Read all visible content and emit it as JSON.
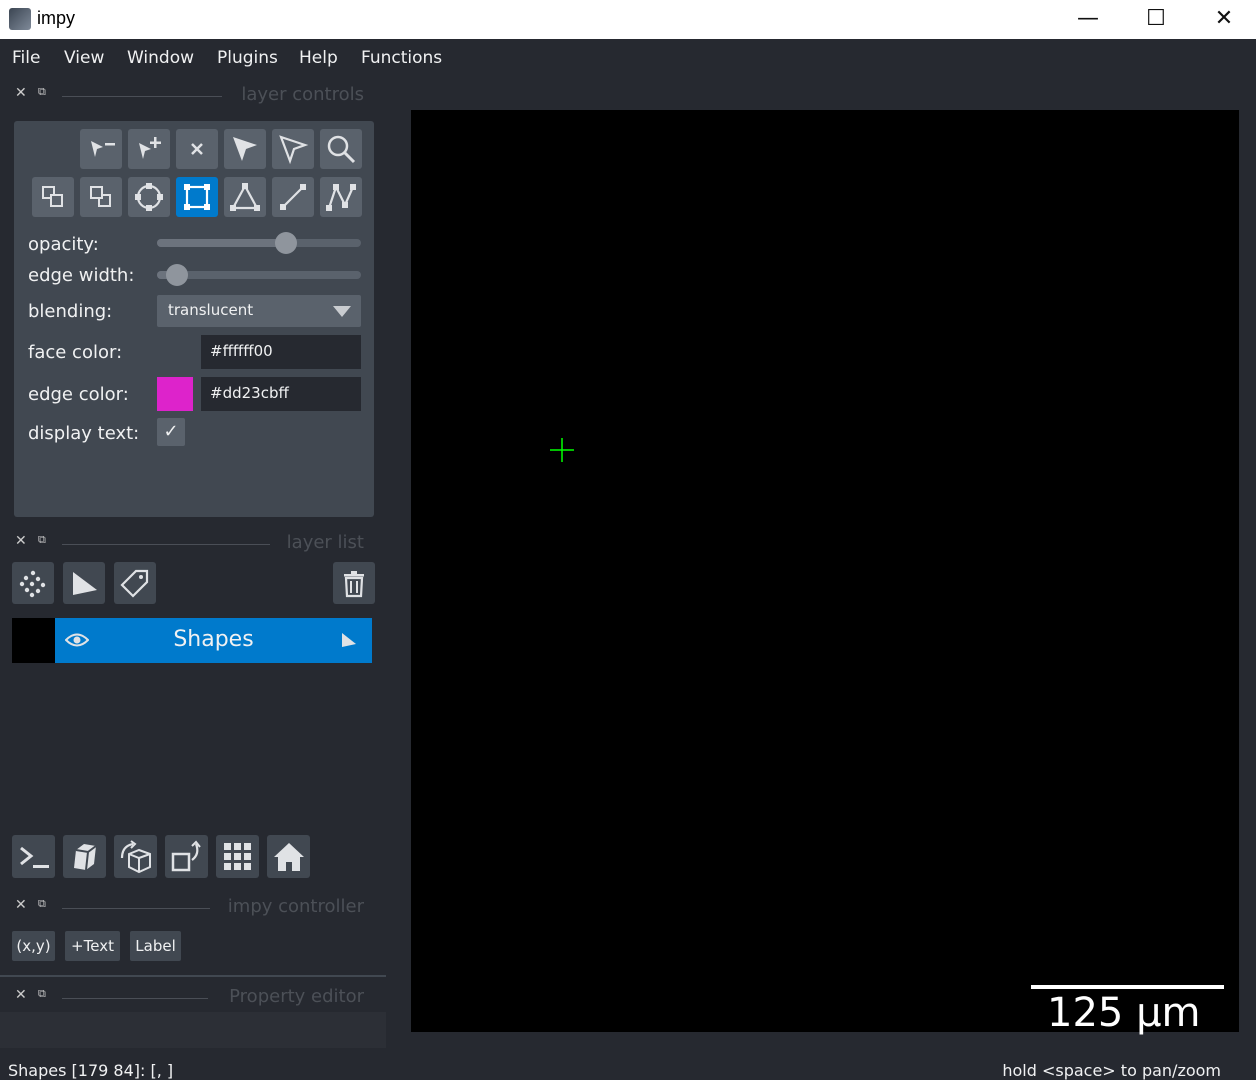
{
  "window": {
    "title": "impy",
    "minimize": "—",
    "maximize": "☐",
    "close": "✕"
  },
  "menu": [
    "File",
    "View",
    "Window",
    "Plugins",
    "Help",
    "Functions"
  ],
  "docks": {
    "layer_controls": "layer controls",
    "layer_list": "layer list",
    "impy_controller": "impy controller",
    "property_editor": "Property editor"
  },
  "layer_controls": {
    "opacity": {
      "label": "opacity:",
      "value": 0.65
    },
    "edge_width": {
      "label": "edge width:",
      "value": 0.05
    },
    "blending": {
      "label": "blending:",
      "value": "translucent"
    },
    "face_color": {
      "label": "face color:",
      "value": "#ffffff00"
    },
    "edge_color": {
      "label": "edge color:",
      "value": "#dd23cbff",
      "swatch": "#dd23cb"
    },
    "display_text": {
      "label": "display text:",
      "checked": true,
      "mark": "✓"
    },
    "active_tool": "add-rectangle"
  },
  "layer_list": {
    "layers": [
      {
        "name": "Shapes",
        "visible": true,
        "selected": true
      }
    ]
  },
  "impy_controller": {
    "buttons": [
      "(x,y)",
      "+Text",
      "Label"
    ]
  },
  "canvas": {
    "scale_bar_label": "125 μm",
    "cursor_color": "#00ff00"
  },
  "status": {
    "left": "Shapes [179  84]: [, ]",
    "right": "hold <space> to pan/zoom"
  },
  "colors": {
    "accent": "#007acc",
    "background": "#262930",
    "panel": "#414851"
  }
}
